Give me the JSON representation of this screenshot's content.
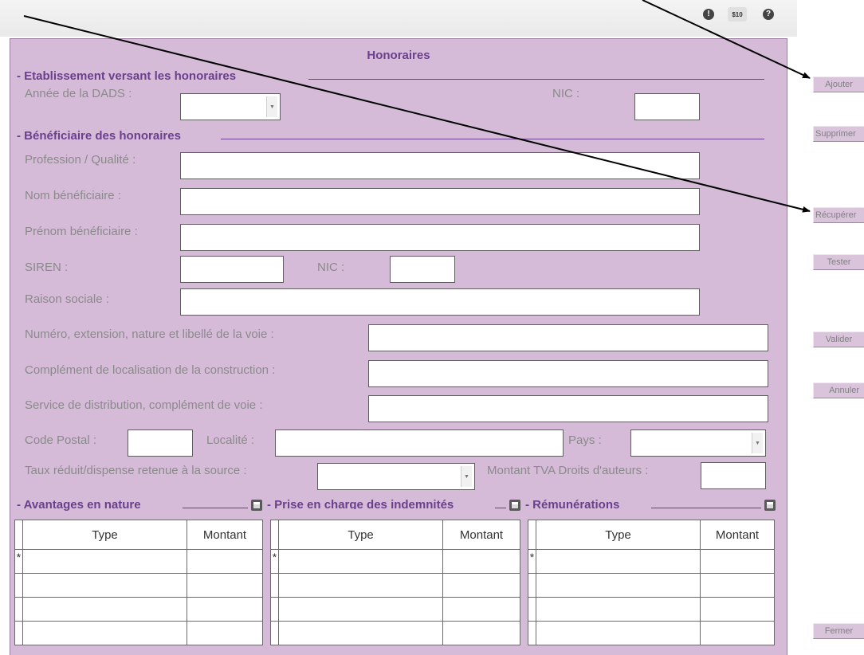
{
  "topbar": {
    "icons": [
      {
        "name": "info-icon",
        "glyph": "!"
      },
      {
        "name": "price-icon",
        "glyph": "$10"
      },
      {
        "name": "help-icon",
        "glyph": "?"
      }
    ]
  },
  "form": {
    "title": "Honoraires",
    "etablissement": {
      "section_title": "- Etablissement versant les honoraires",
      "annee_label": "Année de la DADS :",
      "annee_value": "",
      "nic_label": "NIC :",
      "nic_value": ""
    },
    "beneficiaire": {
      "section_title": "- Bénéficiaire des honoraires",
      "profession_label": "Profession / Qualité :",
      "nom_label": "Nom bénéficiaire :",
      "prenom_label": "Prénom bénéficiaire :",
      "siren_label": "SIREN :",
      "nic_label": "NIC :",
      "raison_label": "Raison sociale :",
      "voie_label": "Numéro, extension, nature et libellé de la voie :",
      "complement_label": "Complément de localisation de la construction :",
      "distribution_label": "Service de distribution, complément de voie :",
      "cp_label": "Code Postal :",
      "localite_label": "Localité :",
      "pays_label": "Pays :",
      "taux_label": "Taux réduit/dispense retenue à la source :",
      "tva_label": "Montant TVA Droits d'auteurs :"
    },
    "grids": [
      {
        "title": "- Avantages en nature",
        "col1": "Type",
        "col2": "Montant",
        "new_row_marker": "*"
      },
      {
        "title": "- Prise en charge des indemnités",
        "col1": "Type",
        "col2": "Montant",
        "new_row_marker": "*"
      },
      {
        "title": "- Rémunérations",
        "col1": "Type",
        "col2": "Montant",
        "new_row_marker": "*"
      }
    ]
  },
  "sidebar": {
    "ajouter": "Ajouter",
    "supprimer": "Supprimer",
    "recuperer": "Récupérer",
    "tester": "Tester",
    "valider": "Valider",
    "annuler": "Annuler",
    "fermer": "Fermer"
  }
}
